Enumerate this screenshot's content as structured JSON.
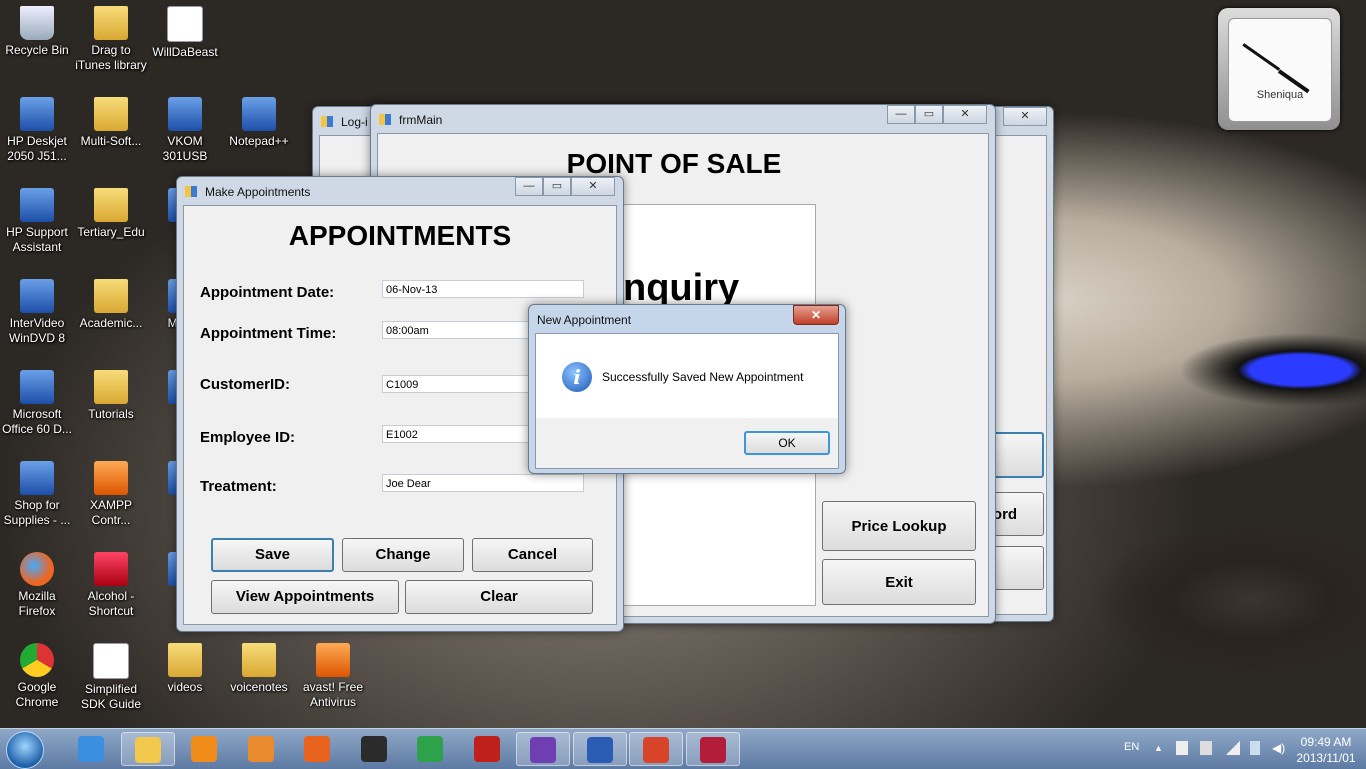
{
  "desktop_icons": [
    {
      "label": "Recycle Bin",
      "icon": "recycle-bin-icon"
    },
    {
      "label": "Drag to iTunes library",
      "icon": "folder-icon"
    },
    {
      "label": "WillDaBeast",
      "icon": "word-document-icon"
    },
    {
      "label": "HP Deskjet 2050 J51...",
      "icon": "printer-icon"
    },
    {
      "label": "Multi-Soft...",
      "icon": "folder-icon"
    },
    {
      "label": "VKOM 301USB",
      "icon": "shortcut-icon"
    },
    {
      "label": "Notepad++",
      "icon": "notepad-plus-plus-icon"
    },
    {
      "label": "HP Support Assistant",
      "icon": "hp-support-icon"
    },
    {
      "label": "Tertiary_Edu",
      "icon": "folder-icon"
    },
    {
      "label": "E",
      "icon": "shortcut-icon"
    },
    {
      "label": "InterVideo WinDVD 8",
      "icon": "windvd-icon"
    },
    {
      "label": "Academic...",
      "icon": "folder-icon"
    },
    {
      "label": "Mec C",
      "icon": "shortcut-icon"
    },
    {
      "label": "Microsoft Office 60 D...",
      "icon": "office-icon"
    },
    {
      "label": "Tutorials",
      "icon": "folder-icon"
    },
    {
      "label": "W",
      "icon": "shortcut-icon"
    },
    {
      "label": "Shop for Supplies - ...",
      "icon": "printer-icon"
    },
    {
      "label": "XAMPP Contr...",
      "icon": "xampp-icon"
    },
    {
      "label": "pi",
      "icon": "shortcut-icon"
    },
    {
      "label": "Mozilla Firefox",
      "icon": "firefox-icon"
    },
    {
      "label": "Alcohol - Shortcut",
      "icon": "alcohol-icon"
    },
    {
      "label": "n",
      "icon": "shortcut-icon"
    },
    {
      "label": "Google Chrome",
      "icon": "chrome-icon"
    },
    {
      "label": "Simplified SDK Guide",
      "icon": "word-document-icon"
    },
    {
      "label": "videos",
      "icon": "folder-icon"
    },
    {
      "label": "voicenotes",
      "icon": "folder-icon"
    },
    {
      "label": "avast! Free Antivirus",
      "icon": "avast-icon"
    }
  ],
  "clock_gadget": {
    "name": "Sheniqua"
  },
  "login_window": {
    "title": "Log-i"
  },
  "main_window": {
    "title": "frmMain",
    "heading": "POINT OF SALE",
    "enquiry_text": "nquiry",
    "buttons": {
      "price_lookup": "Price Lookup",
      "exit": "Exit",
      "record_partial": "ord"
    }
  },
  "appointments_window": {
    "title": "Make Appointments",
    "heading": "APPOINTMENTS",
    "fields": [
      {
        "label": "Appointment Date:",
        "value": "06-Nov-13"
      },
      {
        "label": "Appointment Time:",
        "value": "08:00am"
      },
      {
        "label": "CustomerID:",
        "value": "C1009"
      },
      {
        "label": "Employee ID:",
        "value": "E1002"
      },
      {
        "label": "Treatment:",
        "value": "Joe Dear"
      }
    ],
    "buttons": {
      "save": "Save",
      "change": "Change",
      "cancel": "Cancel",
      "view": "View Appointments",
      "clear": "Clear"
    }
  },
  "message_box": {
    "title": "New Appointment",
    "message": "Successfully Saved New Appointment",
    "ok": "OK"
  },
  "taskbar": {
    "language": "EN",
    "time": "09:49 AM",
    "date": "2013/11/01",
    "pinned": [
      "start-orb-icon",
      "internet-explorer-icon",
      "file-explorer-icon",
      "vlc-icon",
      "media-player-icon",
      "firefox-icon",
      "hp-icon",
      "chrome-icon",
      "acrobat-icon",
      "visual-studio-icon",
      "word-icon",
      "windows-forms-icon",
      "access-icon"
    ]
  }
}
